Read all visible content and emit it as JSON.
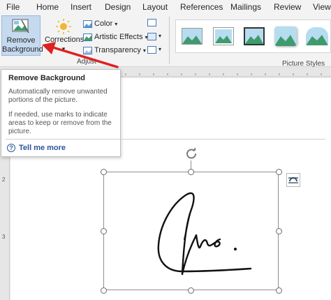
{
  "tabs": [
    "File",
    "Home",
    "Insert",
    "Design",
    "Layout",
    "References",
    "Mailings",
    "Review",
    "View"
  ],
  "ribbon": {
    "remove_background": [
      "Remove",
      "Background"
    ],
    "corrections": "Corrections",
    "color": "Color",
    "artistic_effects": "Artistic Effects",
    "transparency": "Transparency",
    "adjust_group": "Adjust",
    "picture_styles_group": "Picture Styles",
    "dropdown_glyph": "▾"
  },
  "tooltip": {
    "title": "Remove Background",
    "p1": "Automatically remove unwanted portions of the picture.",
    "p2": "If needed, use marks to indicate areas to keep or remove from the picture.",
    "help": "Tell me more",
    "help_glyph": "?"
  },
  "vertical_ruler_numbers": [
    "2",
    "3"
  ],
  "colors": {
    "accent_blue": "#2b579a",
    "arrow_red": "#e02020",
    "ribbon_bg": "#f3f3f3",
    "selected_button_bg": "#c5d9ef"
  }
}
